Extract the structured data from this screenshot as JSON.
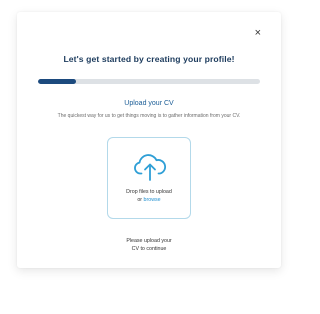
{
  "modal": {
    "close_label": "×",
    "title": "Let's get started by creating your profile!",
    "progress_fraction": 0.17,
    "upload": {
      "heading": "Upload your CV",
      "description": "The quickest way for us to get things moving is to gather information from your CV.",
      "drop_text": "Drop files to upload",
      "or_text": "or ",
      "browse_label": "browse",
      "icon": "cloud-upload-icon"
    },
    "helper_line1": "Please upload your",
    "helper_line2": "CV to continue"
  },
  "colors": {
    "title": "#1b3a5c",
    "accent": "#1b5d96",
    "progress_fill": "#1c4a7e",
    "progress_track": "#dde1e5",
    "link": "#1f8fd0",
    "dropzone_border": "#b3d9ea",
    "icon": "#2f9fd6"
  }
}
